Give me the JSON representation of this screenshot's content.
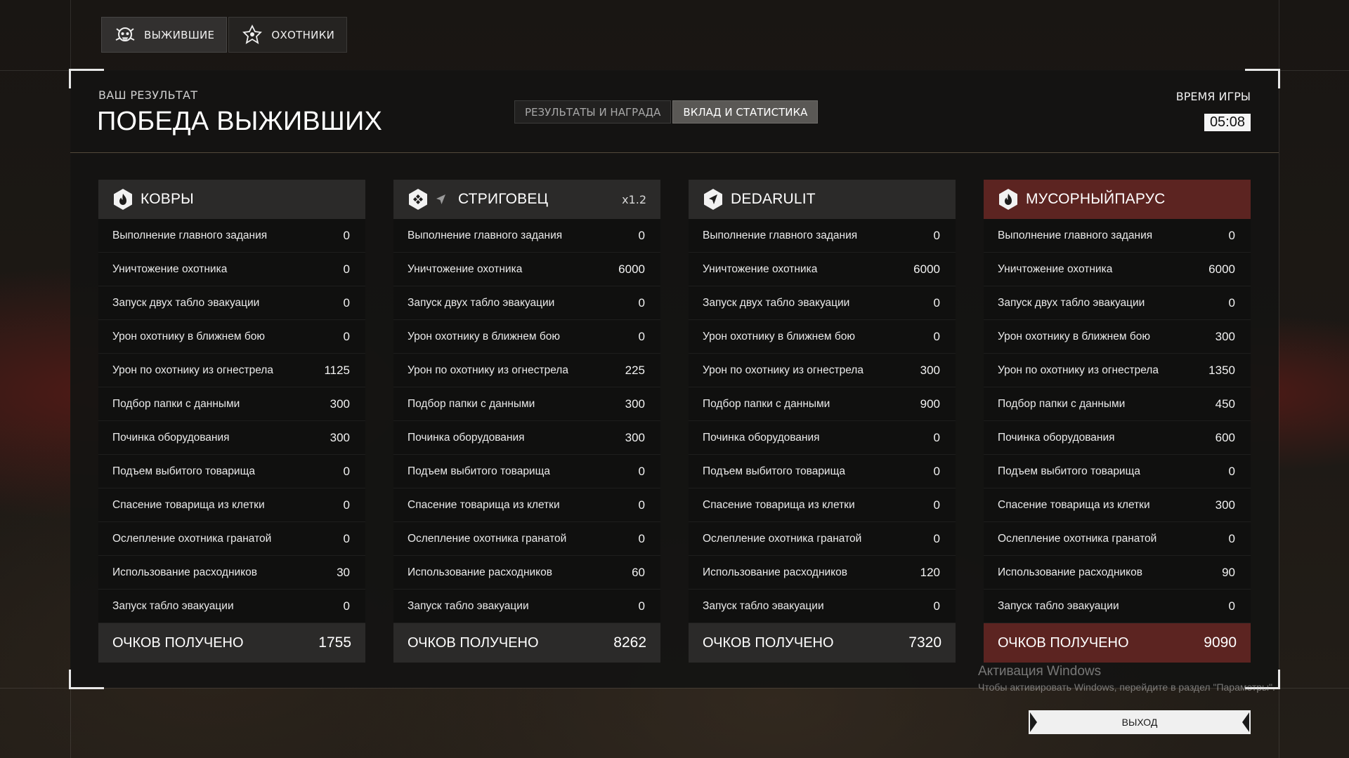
{
  "team_tabs": [
    {
      "label": "ВЫЖИВШИЕ",
      "icon": "survivor-skull-icon",
      "active": true
    },
    {
      "label": "ОХОТНИКИ",
      "icon": "hunter-emblem-icon",
      "active": false
    }
  ],
  "header": {
    "result_label": "ВАШ РЕЗУЛЬТАТ",
    "result_title": "ПОБЕДА ВЫЖИВШИХ",
    "time_label": "ВРЕМЯ ИГРЫ",
    "time_value": "05:08"
  },
  "view_tabs": [
    {
      "label": "РЕЗУЛЬТАТЫ И НАГРАДА",
      "active": false
    },
    {
      "label": "ВКЛАД И СТАТИСТИКА",
      "active": true
    }
  ],
  "players": [
    {
      "name": "КОВРЫ",
      "multiplier": "",
      "icons": [
        "flame-hex-icon"
      ],
      "highlight": false,
      "stats": [
        {
          "label": "Выполнение главного задания",
          "value": "0"
        },
        {
          "label": "Уничтожение охотника",
          "value": "0"
        },
        {
          "label": "Запуск двух табло эвакуации",
          "value": "0"
        },
        {
          "label": "Урон охотнику в ближнем бою",
          "value": "0"
        },
        {
          "label": "Урон по охотнику из огнестрела",
          "value": "1125"
        },
        {
          "label": "Подбор папки с данными",
          "value": "300"
        },
        {
          "label": "Починка оборудования",
          "value": "300"
        },
        {
          "label": "Подъем выбитого товарища",
          "value": "0"
        },
        {
          "label": "Спасение товарища из клетки",
          "value": "0"
        },
        {
          "label": "Ослепление охотника гранатой",
          "value": "0"
        },
        {
          "label": "Использование расходников",
          "value": "30"
        },
        {
          "label": "Запуск табло эвакуации",
          "value": "0"
        }
      ],
      "total_label": "ОЧКОВ ПОЛУЧЕНО",
      "total_value": "1755"
    },
    {
      "name": "СТРИГОВЕЦ",
      "multiplier": "x1.2",
      "icons": [
        "dpad-hex-icon",
        "arrow-icon"
      ],
      "highlight": false,
      "stats": [
        {
          "label": "Выполнение главного задания",
          "value": "0"
        },
        {
          "label": "Уничтожение охотника",
          "value": "6000"
        },
        {
          "label": "Запуск двух табло эвакуации",
          "value": "0"
        },
        {
          "label": "Урон охотнику в ближнем бою",
          "value": "0"
        },
        {
          "label": "Урон по охотнику из огнестрела",
          "value": "225"
        },
        {
          "label": "Подбор папки с данными",
          "value": "300"
        },
        {
          "label": "Починка оборудования",
          "value": "300"
        },
        {
          "label": "Подъем выбитого товарища",
          "value": "0"
        },
        {
          "label": "Спасение товарища из клетки",
          "value": "0"
        },
        {
          "label": "Ослепление охотника гранатой",
          "value": "0"
        },
        {
          "label": "Использование расходников",
          "value": "60"
        },
        {
          "label": "Запуск табло эвакуации",
          "value": "0"
        }
      ],
      "total_label": "ОЧКОВ ПОЛУЧЕНО",
      "total_value": "8262"
    },
    {
      "name": "DEDARULIT",
      "multiplier": "",
      "icons": [
        "arrow-hex-icon"
      ],
      "highlight": false,
      "stats": [
        {
          "label": "Выполнение главного задания",
          "value": "0"
        },
        {
          "label": "Уничтожение охотника",
          "value": "6000"
        },
        {
          "label": "Запуск двух табло эвакуации",
          "value": "0"
        },
        {
          "label": "Урон охотнику в ближнем бою",
          "value": "0"
        },
        {
          "label": "Урон по охотнику из огнестрела",
          "value": "300"
        },
        {
          "label": "Подбор папки с данными",
          "value": "900"
        },
        {
          "label": "Починка оборудования",
          "value": "0"
        },
        {
          "label": "Подъем выбитого товарища",
          "value": "0"
        },
        {
          "label": "Спасение товарища из клетки",
          "value": "0"
        },
        {
          "label": "Ослепление охотника гранатой",
          "value": "0"
        },
        {
          "label": "Использование расходников",
          "value": "120"
        },
        {
          "label": "Запуск табло эвакуации",
          "value": "0"
        }
      ],
      "total_label": "ОЧКОВ ПОЛУЧЕНО",
      "total_value": "7320"
    },
    {
      "name": "МУСОРНЫЙПАРУС",
      "multiplier": "",
      "icons": [
        "flame-hex-icon"
      ],
      "highlight": true,
      "stats": [
        {
          "label": "Выполнение главного задания",
          "value": "0"
        },
        {
          "label": "Уничтожение охотника",
          "value": "6000"
        },
        {
          "label": "Запуск двух табло эвакуации",
          "value": "0"
        },
        {
          "label": "Урон охотнику в ближнем бою",
          "value": "300"
        },
        {
          "label": "Урон по охотнику из огнестрела",
          "value": "1350"
        },
        {
          "label": "Подбор папки с данными",
          "value": "450"
        },
        {
          "label": "Починка оборудования",
          "value": "600"
        },
        {
          "label": "Подъем выбитого товарища",
          "value": "0"
        },
        {
          "label": "Спасение товарища из клетки",
          "value": "300"
        },
        {
          "label": "Ослепление охотника гранатой",
          "value": "0"
        },
        {
          "label": "Использование расходников",
          "value": "90"
        },
        {
          "label": "Запуск табло эвакуации",
          "value": "0"
        }
      ],
      "total_label": "ОЧКОВ ПОЛУЧЕНО",
      "total_value": "9090"
    }
  ],
  "watermark": {
    "title": "Активация Windows",
    "subtitle": "Чтобы активировать Windows, перейдите в раздел \"Параметры\"."
  },
  "exit_button": {
    "label": "ВЫХОД"
  },
  "colors": {
    "highlight": "#5c2421",
    "card_head": "#2b2a29",
    "accent_line": "#a08c6e"
  }
}
